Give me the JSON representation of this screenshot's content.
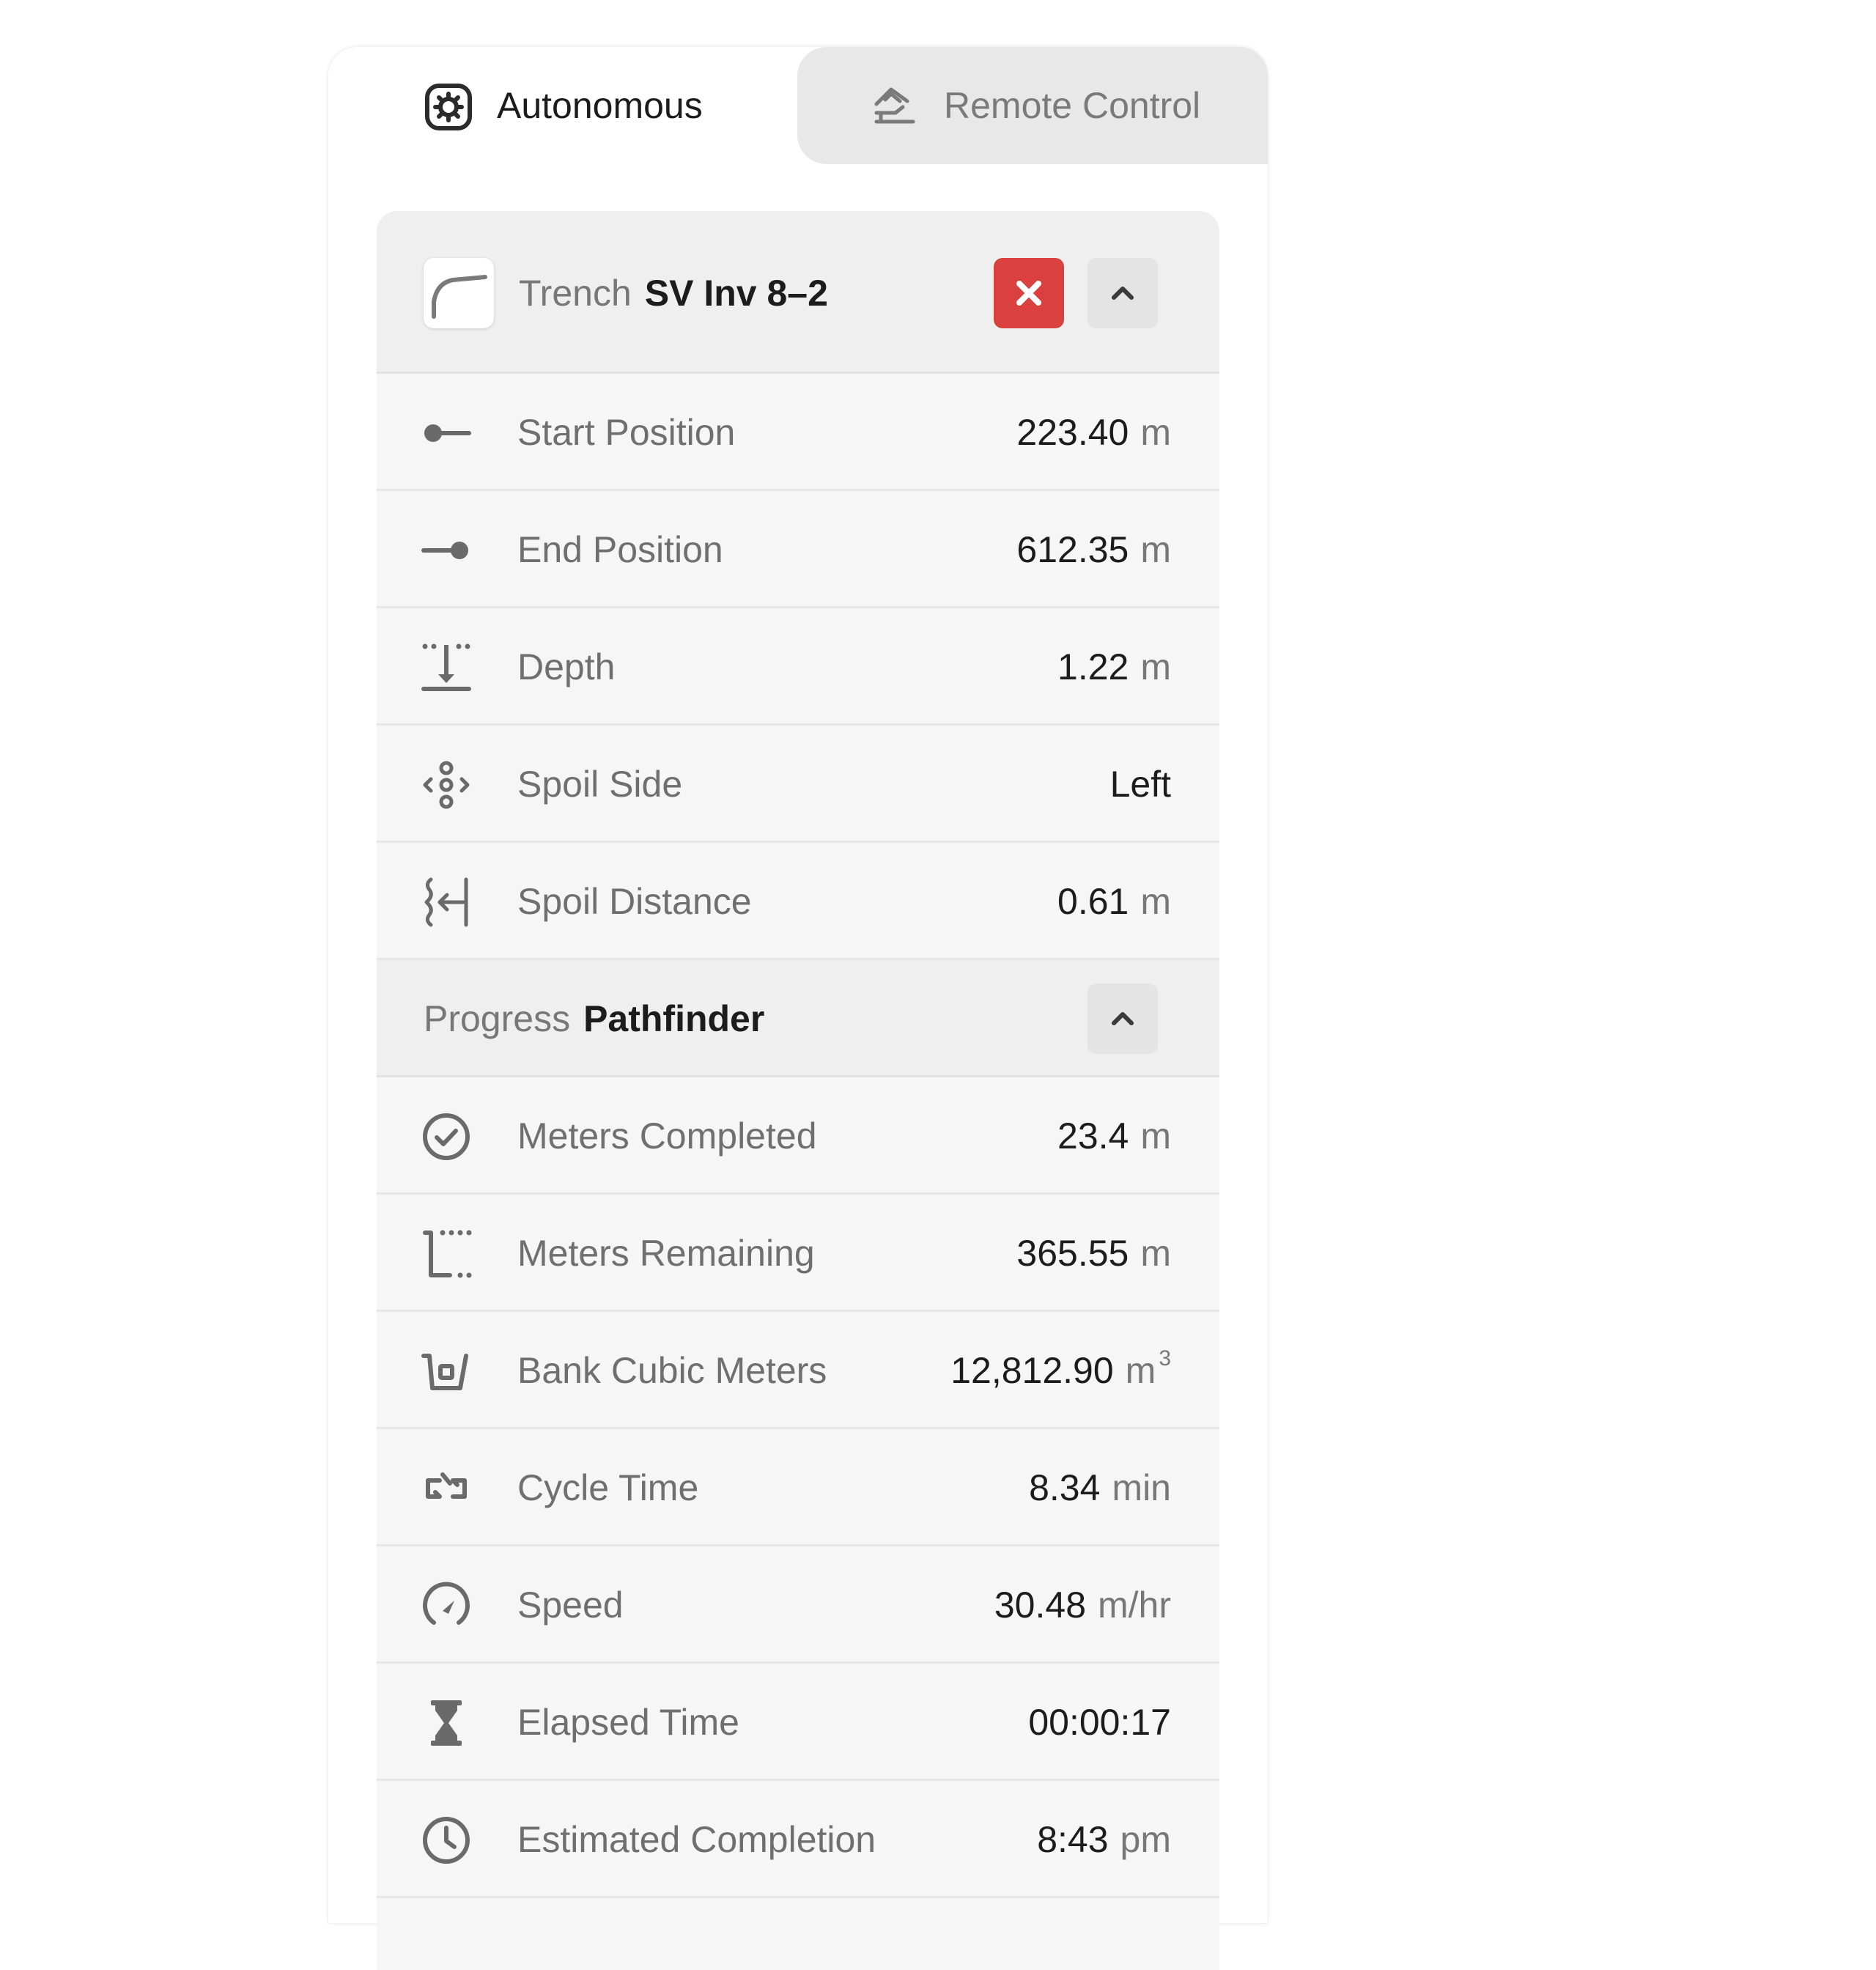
{
  "tabs": {
    "autonomous": {
      "label": "Autonomous",
      "icon": "autonomous-gear-icon"
    },
    "remote": {
      "label": "Remote Control",
      "icon": "remote-control-icon"
    }
  },
  "task": {
    "type_label": "Trench",
    "name": "SV Inv 8–2",
    "icon": "trench-path-icon",
    "close_icon": "close-icon",
    "collapse_icon": "chevron-up-icon"
  },
  "params": [
    {
      "label": "Start Position",
      "value": "223.40",
      "unit": "m",
      "icon": "start-position-icon"
    },
    {
      "label": "End Position",
      "value": "612.35",
      "unit": "m",
      "icon": "end-position-icon"
    },
    {
      "label": "Depth",
      "value": "1.22",
      "unit": "m",
      "icon": "depth-icon"
    },
    {
      "label": "Spoil Side",
      "value": "Left",
      "unit": "",
      "icon": "spoil-side-icon"
    },
    {
      "label": "Spoil Distance",
      "value": "0.61",
      "unit": "m",
      "icon": "spoil-distance-icon"
    }
  ],
  "progress": {
    "label": "Progress",
    "name": "Pathfinder",
    "collapse_icon": "chevron-up-icon"
  },
  "stats": [
    {
      "label": "Meters Completed",
      "value": "23.4",
      "unit": "m",
      "icon": "check-circle-icon"
    },
    {
      "label": "Meters Remaining",
      "value": "365.55",
      "unit": "m",
      "icon": "meters-remaining-icon"
    },
    {
      "label": "Bank Cubic Meters",
      "value": "12,812.90",
      "unit": "m",
      "unit_sup": "3",
      "icon": "bucket-icon"
    },
    {
      "label": "Cycle Time",
      "value": "8.34",
      "unit": "min",
      "icon": "cycle-icon"
    },
    {
      "label": "Speed",
      "value": "30.48",
      "unit": "m/hr",
      "icon": "speedometer-icon"
    },
    {
      "label": "Elapsed Time",
      "value": "00:00:17",
      "unit": "",
      "icon": "hourglass-icon"
    },
    {
      "label": "Estimated Completion",
      "value": "8:43",
      "unit": "pm",
      "icon": "clock-icon"
    }
  ],
  "colors": {
    "danger": "#d9403e",
    "text_dark": "#1c1c1c",
    "text_muted": "#777777",
    "row_bg": "#f6f6f6",
    "header_bg": "#efefef"
  }
}
